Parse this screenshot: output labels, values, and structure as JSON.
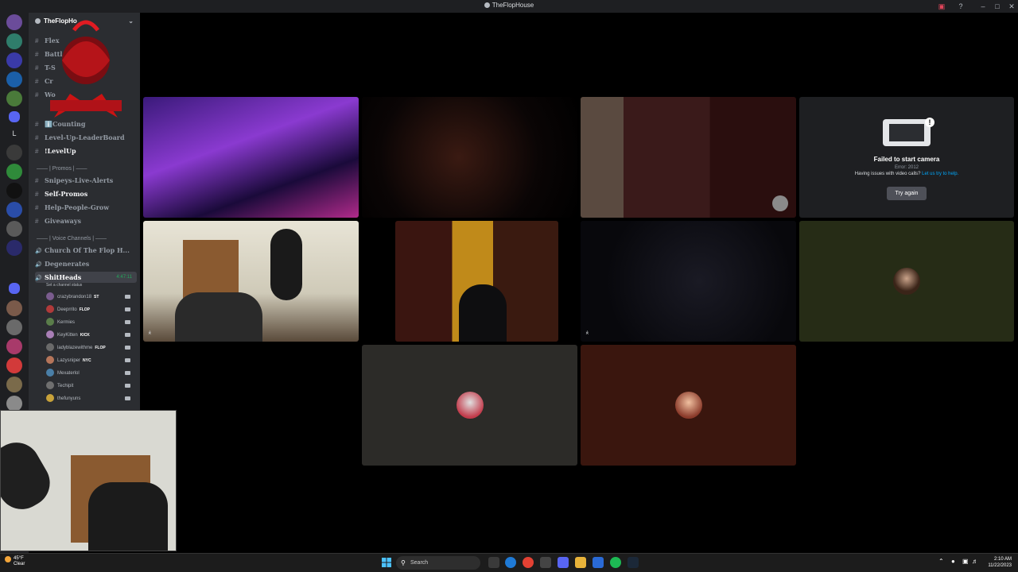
{
  "window": {
    "title": "TheFlopHouse"
  },
  "guild": {
    "name": "TheFlopHo"
  },
  "channels": [
    {
      "label": "Flex"
    },
    {
      "label": "Battl"
    },
    {
      "label": "T-S"
    },
    {
      "label": "Cr"
    },
    {
      "label": "Wo"
    },
    {
      "label": "ℹ️Counting"
    },
    {
      "label": "Level-Up-LeaderBoard"
    },
    {
      "label": "!LevelUp"
    }
  ],
  "categories": {
    "promos": "—— | Promos | ——",
    "voice": "—— | Voice Channels | ——"
  },
  "promo_channels": [
    {
      "label": "Snipeys-Live-Alerts"
    },
    {
      "label": "Self-Promos"
    },
    {
      "label": "Help-People-Grow"
    },
    {
      "label": "Giveaways"
    }
  ],
  "voice_channels": [
    {
      "label": "Church Of The Flop H..."
    },
    {
      "label": "Degenerates"
    },
    {
      "label": "ShitHeads",
      "timer": "4:47:11",
      "status": "Set a channel status"
    }
  ],
  "members": [
    {
      "name": "crazybrandon18",
      "tag": "ST",
      "color": "#7a5c8e"
    },
    {
      "name": "Deeprrito",
      "tag": "FLOP",
      "color": "#b03a3a"
    },
    {
      "name": "Kermies",
      "tag": "",
      "color": "#5a7d4a"
    },
    {
      "name": "KeyKitten",
      "tag": "KICK",
      "color": "#a97fb6"
    },
    {
      "name": "ladyblazewithme",
      "tag": "FLOP",
      "color": "#6a6a6a"
    },
    {
      "name": "Lazysniper",
      "tag": "NYC",
      "color": "#b5755a"
    },
    {
      "name": "Mexaterlol",
      "tag": "",
      "color": "#4a7fa7"
    },
    {
      "name": "Techipit",
      "tag": "",
      "color": "#6f6f6f"
    },
    {
      "name": "thefunyuns",
      "tag": "",
      "color": "#c8a23a"
    }
  ],
  "camera_error": {
    "title": "Failed to start camera",
    "code": "Error: 2012",
    "help_text": "Having issues with video calls?",
    "help_link": "Let us try to help.",
    "button": "Try again"
  },
  "taskbar": {
    "weather_temp": "45°F",
    "weather_cond": "Clear",
    "search_label": "Search",
    "time": "2:10 AM",
    "date": "11/22/2023"
  },
  "colors": {
    "accent_green": "#23a55a",
    "link_blue": "#00a8fc",
    "sidebar": "#2b2d31",
    "rail": "#1e1f22"
  }
}
